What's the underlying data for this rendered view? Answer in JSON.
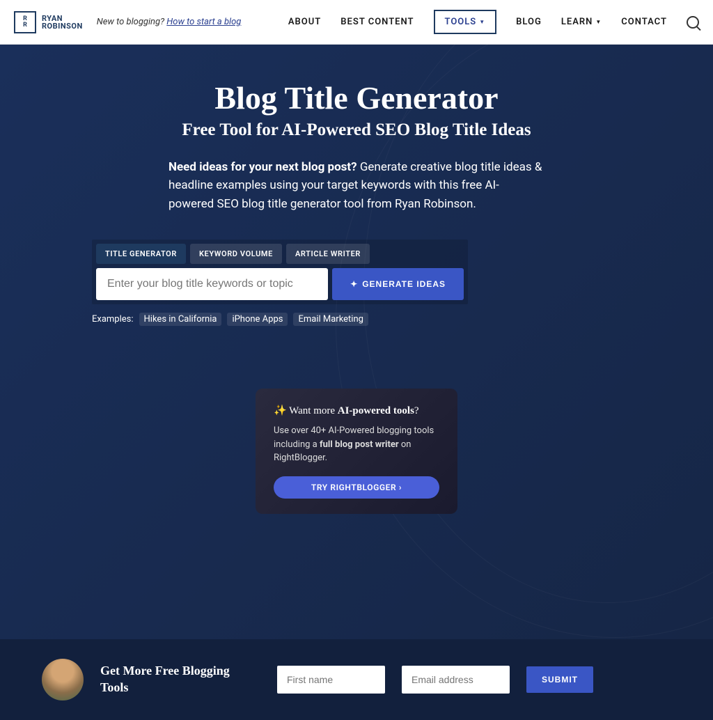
{
  "header": {
    "logo_top": "RYAN",
    "logo_bot": "ROBINSON",
    "tagline_prefix": "New to blogging? ",
    "tagline_link": "How to start a blog",
    "nav": [
      "ABOUT",
      "BEST CONTENT",
      "TOOLS",
      "BLOG",
      "LEARN",
      "CONTACT"
    ]
  },
  "hero": {
    "title": "Blog Title Generator",
    "subtitle": "Free Tool for AI-Powered SEO Blog Title Ideas",
    "desc_bold": "Need ideas for your next blog post?",
    "desc_rest": " Generate creative blog title ideas & headline examples using your target keywords with this free AI-powered SEO blog title generator tool from Ryan Robinson.",
    "tabs": [
      "TITLE GENERATOR",
      "KEYWORD VOLUME",
      "ARTICLE WRITER"
    ],
    "input_placeholder": "Enter your blog title keywords or topic",
    "button": "GENERATE IDEAS",
    "examples_label": "Examples:",
    "examples": [
      "Hikes in California",
      "iPhone Apps",
      "Email Marketing"
    ]
  },
  "promo": {
    "title_pre": "✨ Want more ",
    "title_bold": "AI-powered tools",
    "title_post": "?",
    "body_pre": "Use over 40+ AI-Powered blogging tools including a ",
    "body_bold": "full blog post writer",
    "body_post": " on RightBlogger.",
    "cta": "TRY RIGHTBLOGGER ›"
  },
  "footer": {
    "title": "Get More Free Blogging Tools",
    "first_ph": "First name",
    "email_ph": "Email address",
    "submit": "SUBMIT"
  }
}
